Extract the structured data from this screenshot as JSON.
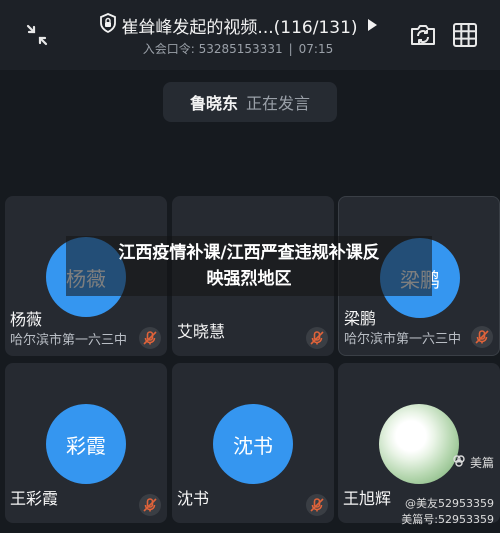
{
  "header": {
    "title": "崔耸峰发起的视频...(116/131)",
    "meeting_id_label": "入会口令: 53285153331",
    "separator": "|",
    "elapsed_time": "07:15"
  },
  "speaker": {
    "name": "鲁晓东",
    "status": "正在发言"
  },
  "banner": {
    "line1": "江西疫情补课/江西严查违规补课反",
    "line2": "映强烈地区"
  },
  "participants": [
    {
      "avatar_text": "杨薇",
      "name": "杨薇",
      "subtitle": "哈尔滨市第一六三中"
    },
    {
      "avatar_text": "艾晓慧",
      "name": "艾晓慧",
      "subtitle": ""
    },
    {
      "avatar_text": "梁鹏",
      "name": "梁鹏",
      "subtitle": "哈尔滨市第一六三中"
    },
    {
      "avatar_text": "彩霞",
      "name": "王彩霞",
      "subtitle": ""
    },
    {
      "avatar_text": "沈书",
      "name": "沈书",
      "subtitle": ""
    },
    {
      "avatar_text": "",
      "name": "王旭辉",
      "subtitle": ""
    }
  ],
  "watermark": {
    "brand": "美篇",
    "friend": "@美友52953359",
    "id": "美篇号:52953359"
  },
  "icons": [
    "minimize-icon",
    "shield-icon",
    "play-icon",
    "camera-switch-icon",
    "grid-view-icon",
    "mic-off-icon"
  ],
  "colors": {
    "avatar_blue": "#3596f0",
    "background": "#161a1f",
    "tile": "#262a31"
  }
}
